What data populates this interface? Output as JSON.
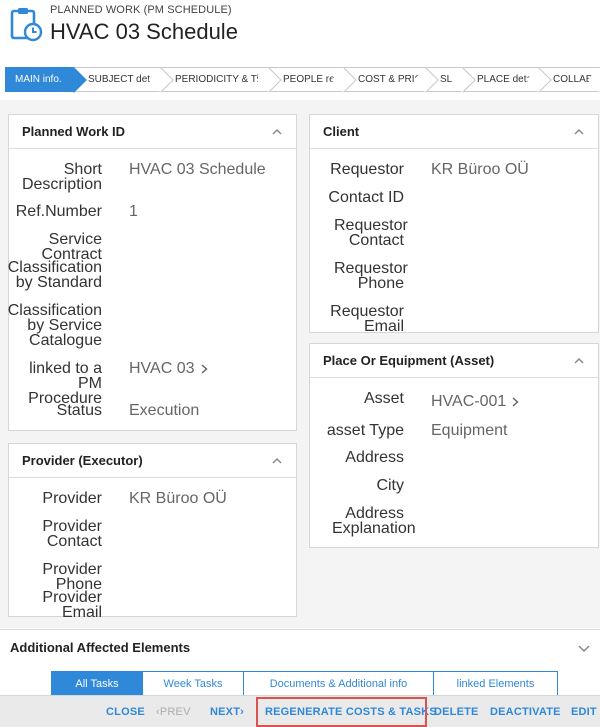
{
  "header": {
    "subtitle": "PLANNED WORK (PM SCHEDULE)",
    "title": "HVAC 03 Schedule",
    "accent": "#2f88d8"
  },
  "steps": [
    {
      "label": "MAIN info.",
      "active": true
    },
    {
      "label": "SUBJECT details"
    },
    {
      "label": "PERIODICITY & Time"
    },
    {
      "label": "PEOPLE resp."
    },
    {
      "label": "COST & PRICE"
    },
    {
      "label": "SLA"
    },
    {
      "label": "PLACE details"
    },
    {
      "label": "COLLAB."
    }
  ],
  "planned_work": {
    "title": "Planned Work ID",
    "short_description_label": "Short Description",
    "short_description_value": "HVAC 03 Schedule",
    "ref_number_label": "Ref.Number",
    "ref_number_value": "1",
    "service_contract_label": "Service Contract",
    "classification_standard_label": "Classification by Standard",
    "classification_catalogue_label": "Classification by Service Catalogue",
    "pm_procedure_label": "linked to a PM Procedure",
    "pm_procedure_value": "HVAC 03",
    "status_label": "Status",
    "status_value": "Execution"
  },
  "provider": {
    "title": "Provider (Executor)",
    "provider_label": "Provider",
    "provider_value": "KR Büroo OÜ",
    "contact_label": "Provider Contact",
    "phone_label": "Provider Phone",
    "email_label": "Provider Email"
  },
  "client": {
    "title": "Client",
    "requestor_label": "Requestor",
    "requestor_value": "KR Büroo OÜ",
    "contact_id_label": "Contact ID",
    "requestor_contact_label": "Requestor Contact",
    "requestor_phone_label": "Requestor Phone",
    "requestor_email_label": "Requestor Email"
  },
  "place": {
    "title": "Place Or Equipment (Asset)",
    "asset_label": "Asset",
    "asset_value": "HVAC-001",
    "asset_type_label": "asset Type",
    "asset_type_value": "Equipment",
    "address_label": "Address",
    "city_label": "City",
    "address_explanation_label": "Address Explanation"
  },
  "additional": {
    "title": "Additional Affected Elements"
  },
  "tabs": [
    {
      "label": "All Tasks",
      "active": true
    },
    {
      "label": "Week Tasks"
    },
    {
      "label": "Documents & Additional info"
    },
    {
      "label": "linked Elements"
    }
  ],
  "footer": {
    "close": "CLOSE",
    "prev": "‹PREV",
    "next": "NEXT›",
    "regenerate": "REGENERATE COSTS & TASKS",
    "delete": "DELETE",
    "deactivate": "DEACTIVATE",
    "edit": "EDIT"
  }
}
